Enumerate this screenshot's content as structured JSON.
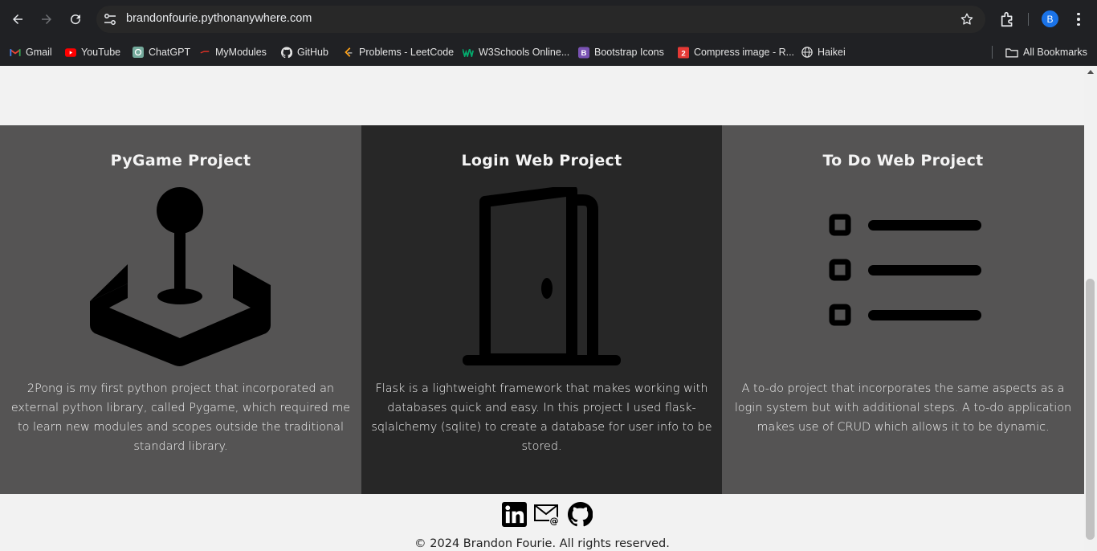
{
  "browser": {
    "url": "brandonfourie.pythonanywhere.com",
    "profile_initial": "B",
    "bookmarks": [
      {
        "label": "Gmail",
        "icon": "gmail-icon"
      },
      {
        "label": "YouTube",
        "icon": "youtube-icon"
      },
      {
        "label": "ChatGPT",
        "icon": "chatgpt-icon"
      },
      {
        "label": "MyModules",
        "icon": "mymodules-icon"
      },
      {
        "label": "GitHub",
        "icon": "github-icon"
      },
      {
        "label": "Problems - LeetCode",
        "icon": "leetcode-icon"
      },
      {
        "label": "W3Schools Online...",
        "icon": "w3schools-icon"
      },
      {
        "label": "Bootstrap Icons",
        "icon": "bootstrap-icon"
      },
      {
        "label": "Compress image - R...",
        "icon": "compress-icon"
      },
      {
        "label": "Haikei",
        "icon": "globe-icon"
      }
    ],
    "all_bookmarks": "All Bookmarks"
  },
  "page": {
    "projects": [
      {
        "title": "PyGame Project",
        "icon": "joystick-icon",
        "description": "2Pong is my first python project that incorporated an external python library, called Pygame, which required me to learn new modules and scopes outside the traditional standard library."
      },
      {
        "title": "Login Web Project",
        "icon": "door-icon",
        "description": "Flask is a lightweight framework that makes working with databases quick and easy. In this project I used flask-sqlalchemy (sqlite) to create a database for user info to be stored."
      },
      {
        "title": "To Do Web Project",
        "icon": "checklist-icon",
        "description": "A to-do project that incorporates the same aspects as a login system but with additional steps. A to-do application makes use of CRUD which allows it to be dynamic."
      }
    ],
    "footer": {
      "icons": [
        "linkedin-icon",
        "email-icon",
        "github-icon"
      ],
      "copyright": "© 2024 Brandon Fourie. All rights reserved."
    }
  },
  "colors": {
    "card_light": "#555454",
    "card_dark": "#272727",
    "page_bg": "#f2f2f2",
    "chrome_bg": "#202124"
  }
}
